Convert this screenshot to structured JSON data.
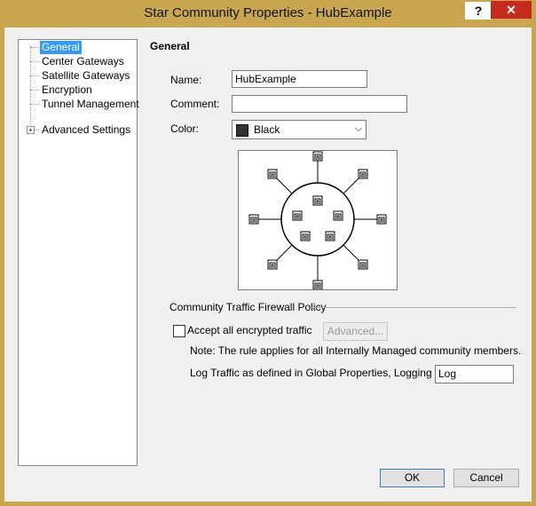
{
  "window": {
    "title": "Star Community Properties - HubExample",
    "help_label": "?",
    "close_label": "✕"
  },
  "tree": {
    "items": [
      {
        "label": "General",
        "selected": true
      },
      {
        "label": "Center Gateways"
      },
      {
        "label": "Satellite Gateways"
      },
      {
        "label": "Encryption"
      },
      {
        "label": "Tunnel Management"
      },
      {
        "label": "Advanced Settings",
        "expandable": true
      }
    ],
    "expander_glyph": "+"
  },
  "general": {
    "heading": "General",
    "name_label": "Name:",
    "name_value": "HubExample",
    "comment_label": "Comment:",
    "comment_value": "",
    "color_label": "Color:",
    "color_value": "Black",
    "color_swatch": "#333333"
  },
  "policy": {
    "group_label": "Community Traffic Firewall Policy",
    "accept_label": "Accept all encrypted traffic",
    "accept_checked": false,
    "advanced_label": "Advanced...",
    "note": "Note: The rule applies for all Internally Managed community members.",
    "log_label": "Log Traffic as defined in Global Properties, Logging Tab:",
    "log_value": "Log"
  },
  "footer": {
    "ok_label": "OK",
    "cancel_label": "Cancel"
  },
  "colors": {
    "title_bar": "#c9a74e",
    "close_red": "#c42b1c",
    "selection": "#3399ff"
  }
}
